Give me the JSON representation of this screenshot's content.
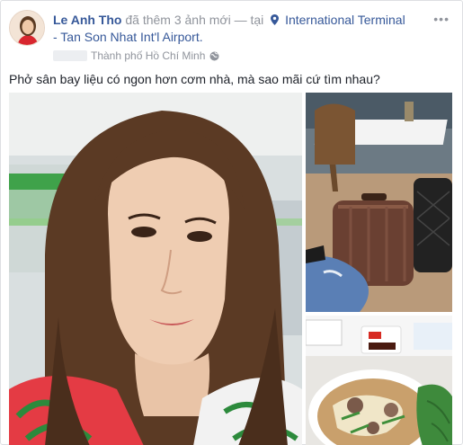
{
  "post": {
    "author": "Le Anh Tho",
    "action": "đã thêm 3 ảnh mới",
    "separator": "—",
    "at": "tại",
    "location": "International Terminal - Tan Son Nhat Int'l Airport.",
    "city": "Thành phố Hồ Chí Minh",
    "more": "•••",
    "caption": "Phở sân bay liệu có ngon hơn cơm nhà, mà sao mãi cứ tìm nhau?"
  },
  "icons": {
    "location": "map-pin-icon",
    "privacy": "globe-icon",
    "options": "more-options-icon"
  },
  "colors": {
    "link": "#365899",
    "meta": "#90949c",
    "text": "#1d2129",
    "border": "#dddfe2"
  }
}
